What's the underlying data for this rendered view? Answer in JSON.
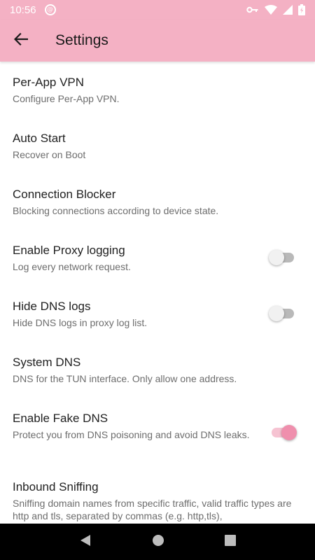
{
  "status_bar": {
    "time": "10:56"
  },
  "app_bar": {
    "title": "Settings"
  },
  "items": [
    {
      "title": "Per-App VPN",
      "summary": "Configure Per-App VPN."
    },
    {
      "title": "Auto Start",
      "summary": "Recover on Boot"
    },
    {
      "title": "Connection Blocker",
      "summary": "Blocking connections according to device state."
    },
    {
      "title": "Enable Proxy logging",
      "summary": "Log every network request.",
      "switch": false
    },
    {
      "title": "Hide DNS logs",
      "summary": "Hide DNS logs in proxy log list.",
      "switch": false
    },
    {
      "title": "System DNS",
      "summary": "DNS for the TUN interface. Only allow one address."
    },
    {
      "title": "Enable Fake DNS",
      "summary": "Protect you from DNS poisoning and avoid DNS leaks.",
      "switch": true
    },
    {
      "title": "Inbound Sniffing",
      "summary": "Sniffing domain names from specific traffic, valid traffic types are http and tls, separated by commas (e.g. http,tls),"
    }
  ],
  "colors": {
    "accent": "#f4b1c4",
    "switch_on": "#ef8fad"
  },
  "icons": [
    "vpn-key-icon",
    "wifi-icon",
    "signal-icon",
    "battery-icon",
    "back-arrow-icon",
    "nav-back-icon",
    "nav-home-icon",
    "nav-recents-icon"
  ]
}
